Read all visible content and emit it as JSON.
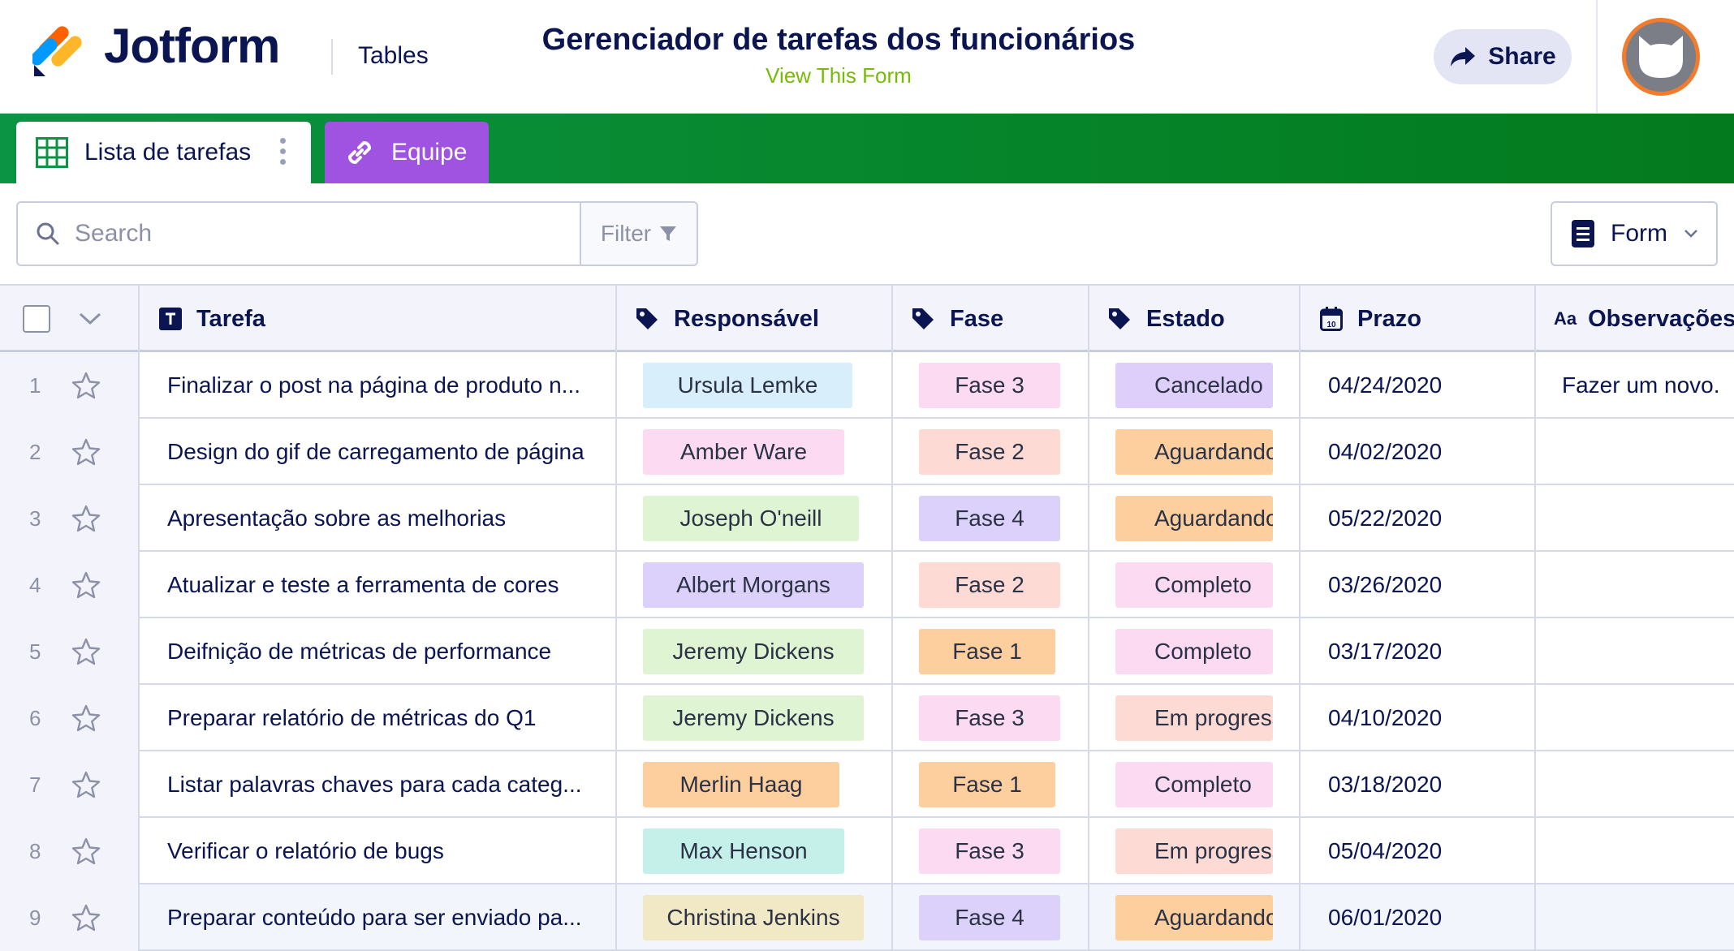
{
  "header": {
    "brand": "Jotform",
    "product": "Tables",
    "title": "Gerenciador de tarefas dos funcionários",
    "view_form": "View This Form",
    "share": "Share"
  },
  "tabs": [
    {
      "label": "Lista de tarefas",
      "icon": "grid-table-icon",
      "active": true
    },
    {
      "label": "Equipe",
      "icon": "link-icon",
      "active": false,
      "color": "#a052e0"
    }
  ],
  "toolbar": {
    "search_placeholder": "Search",
    "filter": "Filter",
    "form": "Form"
  },
  "columns": [
    {
      "label": "Tarefa",
      "icon": "text-type-icon"
    },
    {
      "label": "Responsável",
      "icon": "tag-icon"
    },
    {
      "label": "Fase",
      "icon": "tag-icon"
    },
    {
      "label": "Estado",
      "icon": "tag-icon"
    },
    {
      "label": "Prazo",
      "icon": "calendar-icon"
    },
    {
      "label": "Observações",
      "icon": "aa-text-icon",
      "icon_text": "Aa"
    }
  ],
  "rows": [
    {
      "num": "1",
      "task": "Finalizar o post na página de produto n...",
      "resp": {
        "text": "Ursula Lemke",
        "color": "#d8eefb"
      },
      "fase": {
        "text": "Fase 3",
        "color": "#fcdaf1"
      },
      "estado": {
        "text": "Cancelado",
        "color": "#decffa"
      },
      "prazo": "04/24/2020",
      "obs": "Fazer um novo."
    },
    {
      "num": "2",
      "task": "Design do gif de carregamento de página",
      "resp": {
        "text": "Amber Ware",
        "color": "#fcdaf1"
      },
      "fase": {
        "text": "Fase 2",
        "color": "#fddad3"
      },
      "estado": {
        "text": "Aguardando",
        "color": "#fdcf9f"
      },
      "prazo": "04/02/2020",
      "obs": ""
    },
    {
      "num": "3",
      "task": "Apresentação sobre as melhorias",
      "resp": {
        "text": "Joseph O'neill",
        "color": "#dff4d3"
      },
      "fase": {
        "text": "Fase 4",
        "color": "#dcd1fb"
      },
      "estado": {
        "text": "Aguardando",
        "color": "#fdcf9f"
      },
      "prazo": "05/22/2020",
      "obs": ""
    },
    {
      "num": "4",
      "task": "Atualizar e teste a ferramenta de cores",
      "resp": {
        "text": "Albert Morgans",
        "color": "#dcd1fb"
      },
      "fase": {
        "text": "Fase 2",
        "color": "#fddad3"
      },
      "estado": {
        "text": "Completo",
        "color": "#fcdaf1"
      },
      "prazo": "03/26/2020",
      "obs": ""
    },
    {
      "num": "5",
      "task": "Deifnição de métricas de performance",
      "resp": {
        "text": "Jeremy Dickens",
        "color": "#dff4d3"
      },
      "fase": {
        "text": "Fase 1",
        "color": "#fdcf9f"
      },
      "estado": {
        "text": "Completo",
        "color": "#fcdaf1"
      },
      "prazo": "03/17/2020",
      "obs": ""
    },
    {
      "num": "6",
      "task": "Preparar relatório de métricas do Q1",
      "resp": {
        "text": "Jeremy Dickens",
        "color": "#dff4d3"
      },
      "fase": {
        "text": "Fase 3",
        "color": "#fcdaf1"
      },
      "estado": {
        "text": "Em progress",
        "color": "#fddad3"
      },
      "prazo": "04/10/2020",
      "obs": ""
    },
    {
      "num": "7",
      "task": "Listar palavras chaves para cada categ...",
      "resp": {
        "text": "Merlin Haag",
        "color": "#fdcf9f"
      },
      "fase": {
        "text": "Fase 1",
        "color": "#fdcf9f"
      },
      "estado": {
        "text": "Completo",
        "color": "#fcdaf1"
      },
      "prazo": "03/18/2020",
      "obs": ""
    },
    {
      "num": "8",
      "task": "Verificar o relatório de bugs",
      "resp": {
        "text": "Max Henson",
        "color": "#c5efe9"
      },
      "fase": {
        "text": "Fase 3",
        "color": "#fcdaf1"
      },
      "estado": {
        "text": "Em progress",
        "color": "#fddad3"
      },
      "prazo": "05/04/2020",
      "obs": ""
    },
    {
      "num": "9",
      "task": "Preparar conteúdo para ser enviado pa...",
      "resp": {
        "text": "Christina Jenkins",
        "color": "#f1e8c5"
      },
      "fase": {
        "text": "Fase 4",
        "color": "#dcd1fb"
      },
      "estado": {
        "text": "Aguardando",
        "color": "#fdcf9f"
      },
      "prazo": "06/01/2020",
      "obs": ""
    }
  ]
}
